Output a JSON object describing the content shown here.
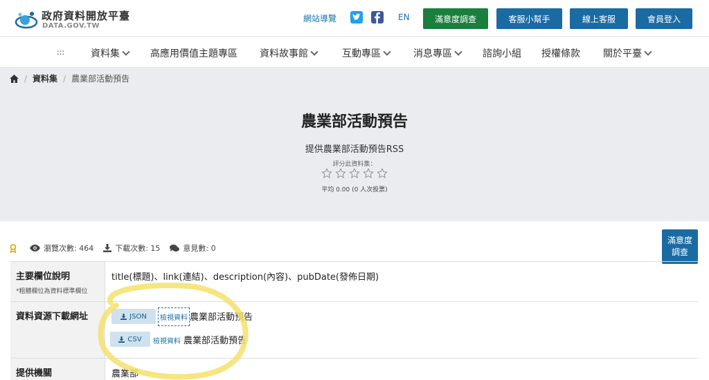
{
  "header": {
    "site_title": "政府資料開放平臺",
    "site_sub": "DATA.GOV.TW",
    "sitemap": "網站導覽",
    "lang": "EN",
    "btn_survey": "滿意度調查",
    "btn_helper": "客服小幫手",
    "btn_online": "線上客服",
    "btn_login": "會員登入",
    "colors": {
      "green": "#1a7f3c",
      "blue": "#1b6ba3",
      "twitter": "#1da1f2",
      "facebook": "#3b5998"
    }
  },
  "nav": {
    "anchor": ":::",
    "items": [
      "資料集",
      "高應用價值主題專區",
      "資料故事館",
      "互動專區",
      "消息專區",
      "諮詢小組",
      "授權條款",
      "關於平臺"
    ]
  },
  "breadcrumb": {
    "level1": "資料集",
    "level2": "農業部活動預告"
  },
  "hero": {
    "title": "農業部活動預告",
    "desc": "提供農業部活動預告RSS",
    "rate_label": "評分此資料集：",
    "avg": "平均 0.00 (0 人次投票)",
    "rating": 0,
    "max_rating": 5
  },
  "stats": {
    "views": "瀏覽次數: 464",
    "downloads": "下載次數: 15",
    "comments": "意見數: 0"
  },
  "survey_side": "滿意度調查",
  "table": {
    "fields_label": "主要欄位說明",
    "fields_note": "*粗體欄位為資料標準欄位",
    "fields_value": "title(標題)、link(連結)、description(內容)、pubDate(發佈日期)",
    "download_label": "資料資源下載網址",
    "resources": [
      {
        "format": "JSON",
        "view": "檢視資料",
        "name": "農業部活動預告"
      },
      {
        "format": "CSV",
        "view": "檢視資料",
        "name": "農業部活動預告"
      }
    ],
    "agency_label": "提供機關",
    "agency_value": "農業部"
  }
}
